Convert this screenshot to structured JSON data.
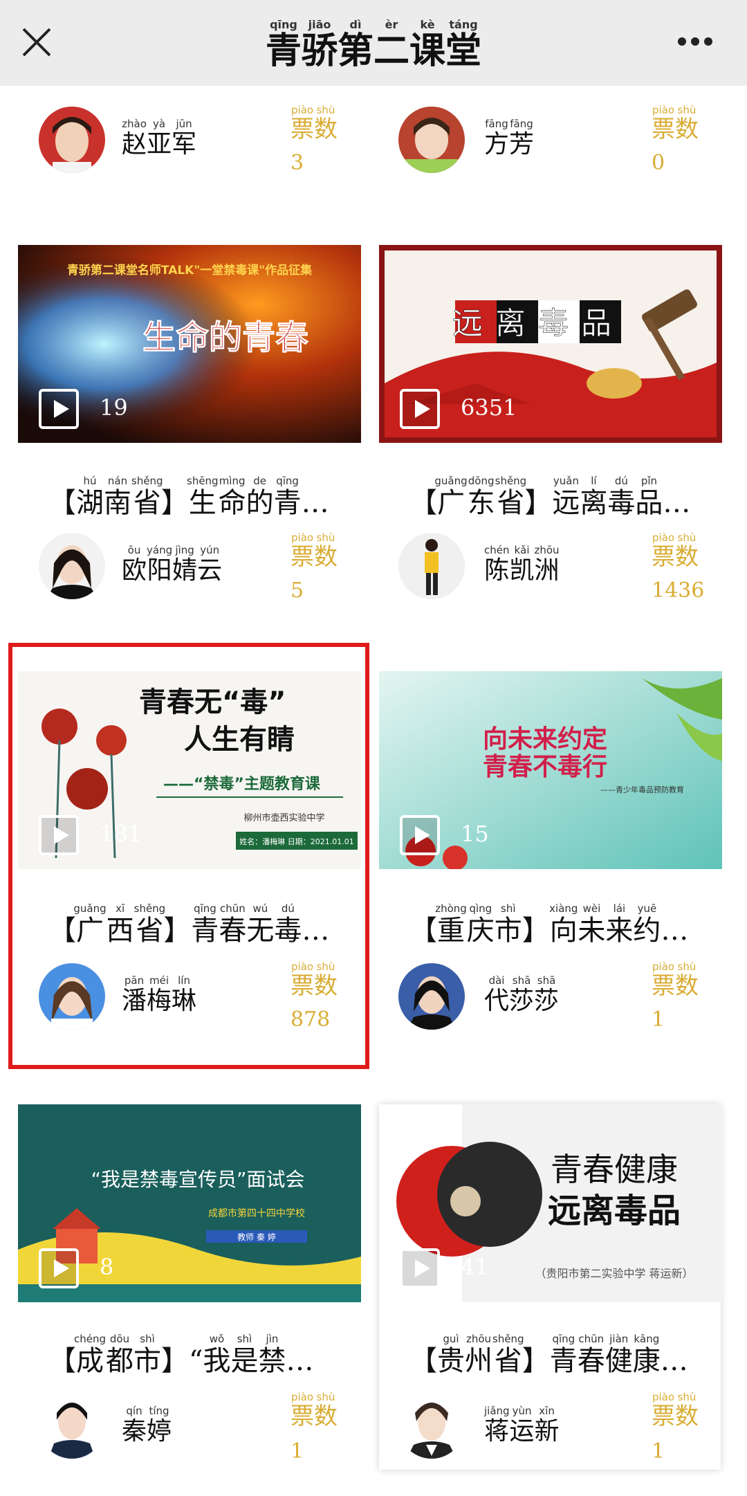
{
  "header": {
    "title": [
      {
        "c": "青",
        "p": "qīng"
      },
      {
        "c": "骄",
        "p": "jiāo"
      },
      {
        "c": "第",
        "p": "dì"
      },
      {
        "c": "二",
        "p": "èr"
      },
      {
        "c": "课",
        "p": "kè"
      },
      {
        "c": "堂",
        "p": "táng"
      }
    ],
    "close_icon": "close-icon",
    "more_icon": "more-icon"
  },
  "vote_label": [
    {
      "c": "票",
      "p": "piào"
    },
    {
      "c": "数",
      "p": "shù"
    }
  ],
  "accent_color": "#d9ad35",
  "highlight_color": "#e01b1b",
  "top_row": [
    {
      "name": [
        {
          "c": "赵",
          "p": "zhào"
        },
        {
          "c": "亚",
          "p": "yà"
        },
        {
          "c": "军",
          "p": "jūn"
        }
      ],
      "votes": "3"
    },
    {
      "name": [
        {
          "c": "方",
          "p": "fāng"
        },
        {
          "c": "芳",
          "p": "fāng"
        }
      ],
      "votes": "0"
    }
  ],
  "cards": [
    {
      "plays": "19",
      "thumb_title": "生命的青春",
      "thumb_banner": "青骄第二课堂名师TALK\"一堂禁毒课\"作品征集",
      "region": [
        {
          "c": "湖",
          "p": "hú"
        },
        {
          "c": "南",
          "p": "nán"
        },
        {
          "c": "省",
          "p": "shěng"
        }
      ],
      "title": [
        {
          "c": "生",
          "p": "shēng"
        },
        {
          "c": "命",
          "p": "mìng"
        },
        {
          "c": "的",
          "p": "de"
        },
        {
          "c": "青",
          "p": "qīng"
        }
      ],
      "name": [
        {
          "c": "欧",
          "p": "ōu"
        },
        {
          "c": "阳",
          "p": "yáng"
        },
        {
          "c": "婧",
          "p": "jìng"
        },
        {
          "c": "云",
          "p": "yún"
        }
      ],
      "votes": "5"
    },
    {
      "plays": "6351",
      "thumb_title": "远离毒品",
      "region": [
        {
          "c": "广",
          "p": "guǎng"
        },
        {
          "c": "东",
          "p": "dōng"
        },
        {
          "c": "省",
          "p": "shěng"
        }
      ],
      "title": [
        {
          "c": "远",
          "p": "yuǎn"
        },
        {
          "c": "离",
          "p": "lí"
        },
        {
          "c": "毒",
          "p": "dú"
        },
        {
          "c": "品",
          "p": "pǐn"
        }
      ],
      "name": [
        {
          "c": "陈",
          "p": "chén"
        },
        {
          "c": "凯",
          "p": "kǎi"
        },
        {
          "c": "洲",
          "p": "zhōu"
        }
      ],
      "votes": "1436"
    },
    {
      "plays": "181",
      "thumb_title_1": "青春无“毒”",
      "thumb_title_2": "人生有睛",
      "thumb_sub": "——“禁毒”主题教育课",
      "thumb_school": "柳州市壶西实验中学",
      "thumb_footer": "姓名：潘梅琳    日期：2021.01.01",
      "region": [
        {
          "c": "广",
          "p": "guǎng"
        },
        {
          "c": "西",
          "p": "xī"
        },
        {
          "c": "省",
          "p": "shěng"
        }
      ],
      "title": [
        {
          "c": "青",
          "p": "qīng"
        },
        {
          "c": "春",
          "p": "chūn"
        },
        {
          "c": "无",
          "p": "wú"
        },
        {
          "c": "毒",
          "p": "dú"
        }
      ],
      "name": [
        {
          "c": "潘",
          "p": "pān"
        },
        {
          "c": "梅",
          "p": "méi"
        },
        {
          "c": "琳",
          "p": "lín"
        }
      ],
      "votes": "878"
    },
    {
      "plays": "15",
      "thumb_title_1": "向未来约定",
      "thumb_title_2": "青春不毒行",
      "thumb_sub": "——青少年毒品预防教育",
      "region": [
        {
          "c": "重",
          "p": "zhòng"
        },
        {
          "c": "庆",
          "p": "qìng"
        },
        {
          "c": "市",
          "p": "shì"
        }
      ],
      "title": [
        {
          "c": "向",
          "p": "xiàng"
        },
        {
          "c": "未",
          "p": "wèi"
        },
        {
          "c": "来",
          "p": "lái"
        },
        {
          "c": "约",
          "p": "yuē"
        }
      ],
      "name": [
        {
          "c": "代",
          "p": "dài"
        },
        {
          "c": "莎",
          "p": "shā"
        },
        {
          "c": "莎",
          "p": "shā"
        }
      ],
      "votes": "1"
    },
    {
      "plays": "8",
      "thumb_title": "“我是禁毒宣传员”面试会",
      "thumb_school": "成都市第四十四中学校",
      "thumb_teacher": "教师    秦  婷",
      "region": [
        {
          "c": "成",
          "p": "chéng"
        },
        {
          "c": "都",
          "p": "dōu"
        },
        {
          "c": "市",
          "p": "shì"
        }
      ],
      "title": [
        {
          "c": "“",
          "p": ""
        },
        {
          "c": "我",
          "p": "wǒ"
        },
        {
          "c": "是",
          "p": "shì"
        },
        {
          "c": "禁",
          "p": "jìn"
        }
      ],
      "name": [
        {
          "c": "秦",
          "p": "qín"
        },
        {
          "c": "婷",
          "p": "tíng"
        }
      ],
      "votes": "1"
    },
    {
      "plays": "41",
      "thumb_title_1": "青春健康",
      "thumb_title_2": "远离毒品",
      "thumb_school": "（贵阳市第二实验中学 蒋运新）",
      "region": [
        {
          "c": "贵",
          "p": "guì"
        },
        {
          "c": "州",
          "p": "zhōu"
        },
        {
          "c": "省",
          "p": "shěng"
        }
      ],
      "title": [
        {
          "c": "青",
          "p": "qīng"
        },
        {
          "c": "春",
          "p": "chūn"
        },
        {
          "c": "健",
          "p": "jiàn"
        },
        {
          "c": "康",
          "p": "kāng"
        }
      ],
      "name": [
        {
          "c": "蒋",
          "p": "jiǎng"
        },
        {
          "c": "运",
          "p": "yùn"
        },
        {
          "c": "新",
          "p": "xīn"
        }
      ],
      "votes": "1"
    }
  ],
  "ellipsis": "…"
}
